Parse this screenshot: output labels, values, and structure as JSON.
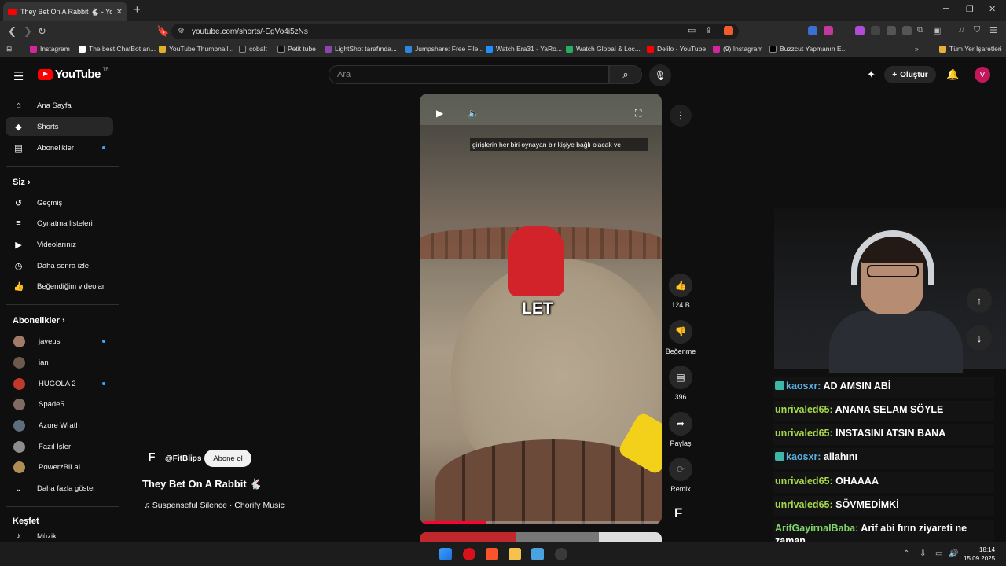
{
  "browser": {
    "tab_title": "They Bet On A Rabbit 🐇 - Yo",
    "url": "youtube.com/shorts/-EgVo4i5zNs",
    "bookmarks": [
      "Instagram",
      "The best ChatBot an...",
      "YouTube Thumbnail...",
      "cobalt",
      "Petit tube",
      "LightShot tarafında...",
      "Jumpshare: Free File...",
      "Watch Era31 - YaRo...",
      "Watch Global & Loc...",
      "Delilo - YouTube",
      "(9) Instagram",
      "Buzzcut Yapmanın E..."
    ],
    "bookmarks_folder": "Tüm Yer İşaretleri"
  },
  "youtube": {
    "logo_text": "YouTube",
    "logo_region": "TR",
    "search_placeholder": "Ara",
    "create_label": "Oluştur",
    "avatar_letter": "V"
  },
  "sidebar": {
    "main": [
      "Ana Sayfa",
      "Shorts",
      "Abonelikler"
    ],
    "you_heading": "Siz",
    "you_items": [
      "Geçmiş",
      "Oynatma listeleri",
      "Videolarınız",
      "Daha sonra izle",
      "Beğendiğim videolar"
    ],
    "subs_heading": "Abonelikler",
    "subs": [
      "javeus",
      "ian",
      "HUGOLA 2",
      "Spade5",
      "Azure Wrath",
      "Fazıl İşler",
      "PowerzBiLaL"
    ],
    "show_more": "Daha fazla göster",
    "explore_heading": "Keşfet",
    "explore_first": "Müzik"
  },
  "short": {
    "caption_small": "girişlerin her biri oynayan bir kişiye bağlı olacak ve",
    "caption_big": "LET",
    "channel_handle": "@FitBlips",
    "channel_initial": "F",
    "subscribe_label": "Abone ol",
    "title": "They Bet On A Rabbit 🐇",
    "music": "♫ Suspenseful Silence · Chorify Music",
    "progress_percent": 27,
    "likes": "124 B",
    "dislike_label": "Beğenme",
    "comments": "396",
    "share_label": "Paylaş",
    "remix_label": "Remix"
  },
  "chat": [
    {
      "user": "kaosxr:",
      "msg": "AD AMSIN ABİ",
      "badge": true,
      "color": "#5ab0e0"
    },
    {
      "user": "unrivaled65:",
      "msg": "ANANA SELAM SÖYLE",
      "badge": false,
      "color": "#a5d94a"
    },
    {
      "user": "unrivaled65:",
      "msg": "İNSTASINI ATSIN BANA",
      "badge": false,
      "color": "#a5d94a"
    },
    {
      "user": "kaosxr:",
      "msg": "allahını",
      "badge": true,
      "color": "#5ab0e0"
    },
    {
      "user": "unrivaled65:",
      "msg": "OHAAAA",
      "badge": false,
      "color": "#a5d94a"
    },
    {
      "user": "unrivaled65:",
      "msg": "SÖVMEDİMKİ",
      "badge": false,
      "color": "#a5d94a"
    },
    {
      "user": "ArifGayirnalBaba:",
      "msg": "Arif abi fırın ziyareti ne zaman",
      "badge": false,
      "color": "#7fd66b"
    }
  ],
  "taskbar": {
    "time": "18:14",
    "date": "15.09.2025"
  }
}
